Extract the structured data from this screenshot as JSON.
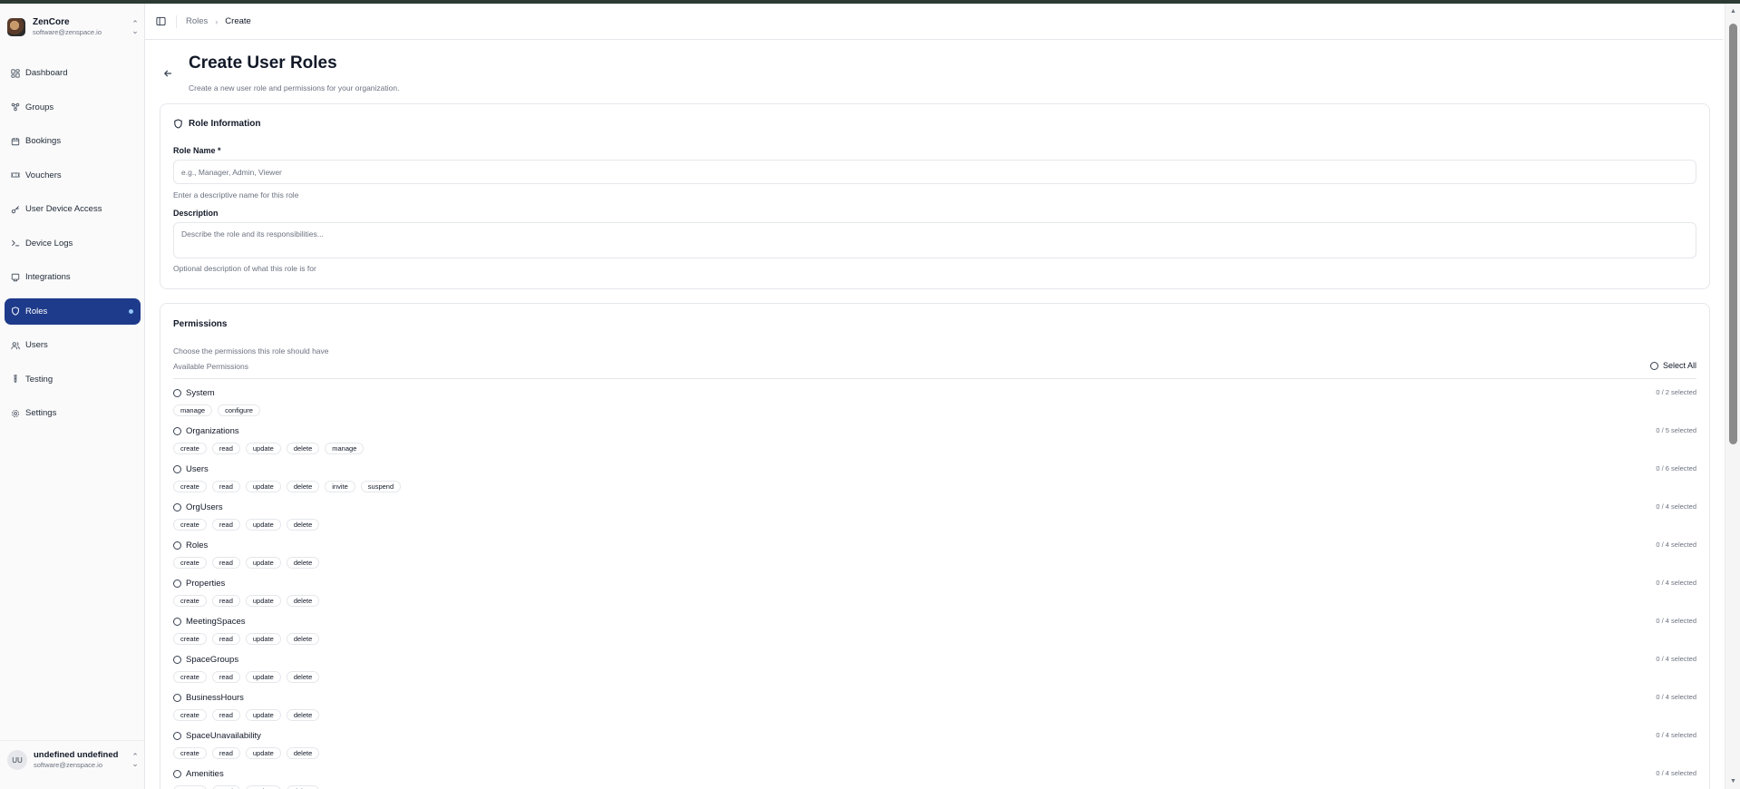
{
  "org": {
    "name": "ZenCore",
    "email": "software@zenspace.io"
  },
  "nav": [
    {
      "label": "Dashboard",
      "icon": "dashboard-icon",
      "active": false
    },
    {
      "label": "Groups",
      "icon": "groups-icon",
      "active": false
    },
    {
      "label": "Bookings",
      "icon": "calendar-icon",
      "active": false
    },
    {
      "label": "Vouchers",
      "icon": "ticket-icon",
      "active": false
    },
    {
      "label": "User Device Access",
      "icon": "key-icon",
      "active": false
    },
    {
      "label": "Device Logs",
      "icon": "terminal-icon",
      "active": false
    },
    {
      "label": "Integrations",
      "icon": "cable-icon",
      "active": false
    },
    {
      "label": "Roles",
      "icon": "shield-icon",
      "active": true
    },
    {
      "label": "Users",
      "icon": "users-icon",
      "active": false
    },
    {
      "label": "Testing",
      "icon": "test-tube-icon",
      "active": false
    },
    {
      "label": "Settings",
      "icon": "gear-icon",
      "active": false
    }
  ],
  "user": {
    "initials": "UU",
    "name": "undefined undefined",
    "email": "software@zenspace.io"
  },
  "breadcrumb": {
    "parent": "Roles",
    "current": "Create"
  },
  "page": {
    "title": "Create User Roles",
    "subtitle": "Create a new user role and permissions for your organization."
  },
  "role_info": {
    "title": "Role Information",
    "name_label": "Role Name *",
    "name_placeholder": "e.g., Manager, Admin, Viewer",
    "name_hint": "Enter a descriptive name for this role",
    "desc_label": "Description",
    "desc_placeholder": "Describe the role and its responsibilities...",
    "desc_hint": "Optional description of what this role is for"
  },
  "permissions": {
    "title": "Permissions",
    "subtitle": "Choose the permissions this role should have",
    "available_label": "Available Permissions",
    "select_all": "Select All",
    "groups": [
      {
        "name": "System",
        "count": "0 / 2 selected",
        "actions": [
          "manage",
          "configure"
        ]
      },
      {
        "name": "Organizations",
        "count": "0 / 5 selected",
        "actions": [
          "create",
          "read",
          "update",
          "delete",
          "manage"
        ]
      },
      {
        "name": "Users",
        "count": "0 / 6 selected",
        "actions": [
          "create",
          "read",
          "update",
          "delete",
          "invite",
          "suspend"
        ]
      },
      {
        "name": "OrgUsers",
        "count": "0 / 4 selected",
        "actions": [
          "create",
          "read",
          "update",
          "delete"
        ]
      },
      {
        "name": "Roles",
        "count": "0 / 4 selected",
        "actions": [
          "create",
          "read",
          "update",
          "delete"
        ]
      },
      {
        "name": "Properties",
        "count": "0 / 4 selected",
        "actions": [
          "create",
          "read",
          "update",
          "delete"
        ]
      },
      {
        "name": "MeetingSpaces",
        "count": "0 / 4 selected",
        "actions": [
          "create",
          "read",
          "update",
          "delete"
        ]
      },
      {
        "name": "SpaceGroups",
        "count": "0 / 4 selected",
        "actions": [
          "create",
          "read",
          "update",
          "delete"
        ]
      },
      {
        "name": "BusinessHours",
        "count": "0 / 4 selected",
        "actions": [
          "create",
          "read",
          "update",
          "delete"
        ]
      },
      {
        "name": "SpaceUnavailability",
        "count": "0 / 4 selected",
        "actions": [
          "create",
          "read",
          "update",
          "delete"
        ]
      },
      {
        "name": "Amenities",
        "count": "0 / 4 selected",
        "actions": [
          "create",
          "read",
          "update",
          "delete"
        ]
      }
    ]
  },
  "colors": {
    "active_nav": "#1e3a8a",
    "top_strip": "#2c3b33",
    "border": "#e5e7eb"
  }
}
